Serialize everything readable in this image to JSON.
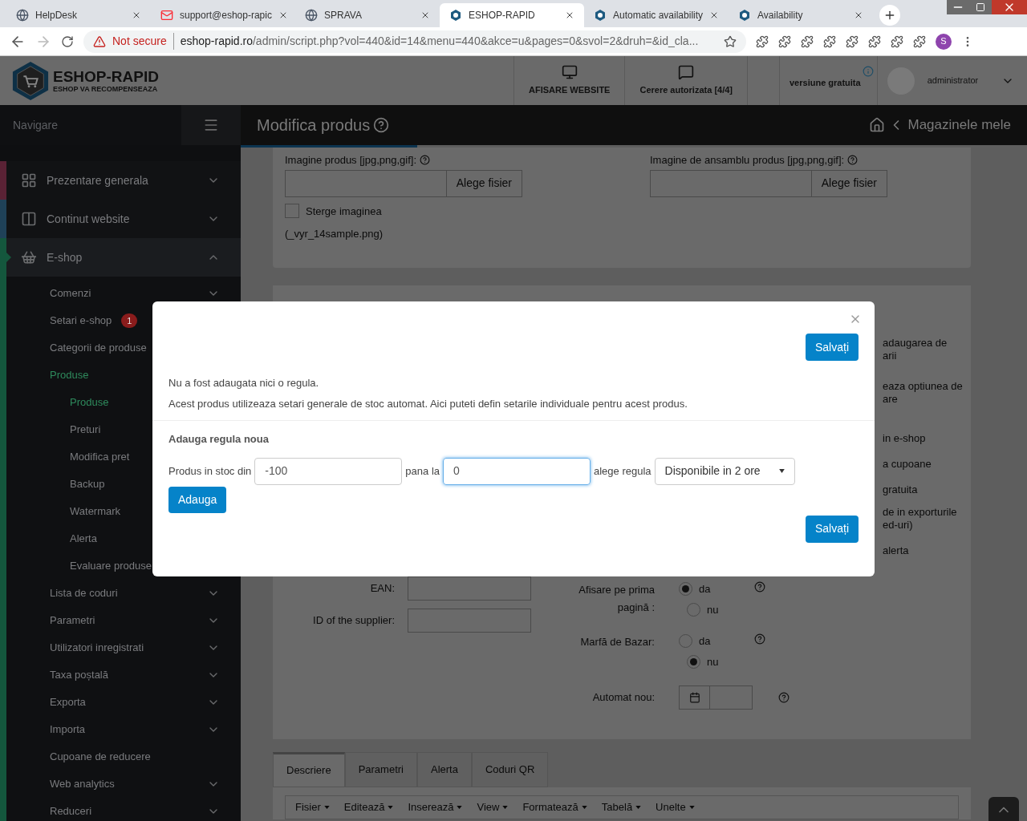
{
  "browser": {
    "tabs": [
      {
        "title": "HelpDesk",
        "kind": "globe",
        "selected": false
      },
      {
        "title": "support@eshop-rapic",
        "kind": "mail",
        "selected": false
      },
      {
        "title": "SPRAVA",
        "kind": "globe",
        "selected": false
      },
      {
        "title": "ESHOP-RAPID",
        "kind": "hex",
        "selected": true
      },
      {
        "title": "Automatic availability",
        "kind": "hex",
        "selected": false
      },
      {
        "title": "Availability",
        "kind": "hex",
        "selected": false
      }
    ],
    "security": "Not secure",
    "url_host": "eshop-rapid.ro",
    "url_path": "/admin/script.php?vol=440&id=14&menu=440&akce=u&pages=0&svol=2&druh=&id_cla...",
    "profile": "S"
  },
  "header": {
    "logo_title": "ESHOP-RAPID",
    "logo_subtitle": "ESHOP VA RECOMPENSEAZA",
    "nav": [
      {
        "label": "AFISARE WEBSITE",
        "kind": "monitor"
      },
      {
        "label": "Cerere autorizata [4/4]",
        "kind": "chat"
      }
    ],
    "version": "versiune gratuita",
    "user": "administrator"
  },
  "sidebar": {
    "heading": "Navigare",
    "items": [
      {
        "label": "Prezentare generala",
        "kind": "group",
        "expanded": false,
        "selected": false,
        "color": "#5a2235"
      },
      {
        "label": "Continut website",
        "kind": "group",
        "expanded": false,
        "selected": false,
        "color": "#1f4158"
      },
      {
        "label": "E-shop",
        "kind": "group",
        "expanded": true,
        "selected": true,
        "color": "#14573d",
        "children": [
          {
            "label": "Comenzi",
            "kind": "group",
            "expanded": false,
            "selected": false
          },
          {
            "label": "Setari e-shop",
            "kind": "link",
            "selected": false,
            "badge": "1"
          },
          {
            "label": "Categorii de produse",
            "kind": "link",
            "selected": false
          },
          {
            "label": "Produse",
            "kind": "link",
            "selected": true,
            "children": [
              {
                "label": "Produse",
                "selected": true
              },
              {
                "label": "Preturi",
                "selected": false
              },
              {
                "label": "Modifica pret",
                "selected": false
              },
              {
                "label": "Backup",
                "selected": false
              },
              {
                "label": "Watermark",
                "selected": false
              },
              {
                "label": "Alerta",
                "selected": false
              },
              {
                "label": "Evaluare produse",
                "selected": false
              }
            ]
          },
          {
            "label": "Lista de coduri",
            "kind": "group",
            "expanded": false,
            "selected": false
          },
          {
            "label": "Parametri",
            "kind": "group",
            "expanded": false,
            "selected": false
          },
          {
            "label": "Utilizatori inregistrati",
            "kind": "group",
            "expanded": false,
            "selected": false
          },
          {
            "label": "Taxa poștală",
            "kind": "group",
            "expanded": false,
            "selected": false
          },
          {
            "label": "Exporta",
            "kind": "group",
            "expanded": false,
            "selected": false
          },
          {
            "label": "Importa",
            "kind": "group",
            "expanded": false,
            "selected": false
          },
          {
            "label": "Cupoane de reducere",
            "kind": "link",
            "selected": false
          },
          {
            "label": "Web analytics",
            "kind": "group",
            "expanded": false,
            "selected": false
          },
          {
            "label": "Reduceri",
            "kind": "group",
            "expanded": false,
            "selected": false
          }
        ]
      }
    ]
  },
  "page_title": "Modifica produs",
  "breadcrumb": "Magazinele mele",
  "uploads": [
    {
      "label": "Imagine produs [jpg,png,gif]:",
      "button": "Alege fisier"
    },
    {
      "label": "Imagine de ansamblu produs [jpg,png,gif]:",
      "button": "Alege fisier"
    }
  ],
  "delete_image": {
    "label": "Sterge imaginea",
    "checked": false
  },
  "filename": "(_vyr_14sample.png)",
  "side_texts": [
    "adaugarea de",
    "arii",
    "eaza optiunea de",
    "are",
    "in e-shop",
    "a cupoane",
    "gratuita",
    "de in exporturile",
    "ed-uri)",
    "alerta"
  ],
  "fields": [
    {
      "label": "EAN:"
    },
    {
      "label": "ID of the supplier:"
    }
  ],
  "radio_groups": [
    {
      "label": "Afisare pe prima pagină :",
      "options": [
        {
          "label": "da",
          "selected": true
        },
        {
          "label": "nu",
          "selected": false
        }
      ]
    },
    {
      "label": "Marfă de Bazar:",
      "options": [
        {
          "label": "da",
          "selected": false
        },
        {
          "label": "nu",
          "selected": true
        }
      ]
    }
  ],
  "date_field": {
    "label": "Automat nou:"
  },
  "tabs": [
    {
      "label": "Descriere",
      "selected": true
    },
    {
      "label": "Parametri",
      "selected": false
    },
    {
      "label": "Alerta",
      "selected": false
    },
    {
      "label": "Coduri QR",
      "selected": false
    }
  ],
  "editor_menu": [
    "Fisier",
    "Editează",
    "Inserează",
    "View",
    "Formatează",
    "Tabelă",
    "Unelte"
  ],
  "modal": {
    "save": "Salvați",
    "messages": [
      "Nu a fost adaugata nici o regula.",
      "Acest produs utilizeaza setari generale de stoc automat. Aici puteti defin setarile individuale pentru acest produs."
    ],
    "section": "Adauga regula noua",
    "from_label": "Produs in stoc din",
    "from": {
      "value": "-100",
      "focused": false
    },
    "to_label": "pana la",
    "to": {
      "value": "0",
      "focused": true
    },
    "rule_label": "alege regula",
    "rule": "Disponibile in 2 ore",
    "add": "Adauga",
    "save_bottom": "Salvați"
  }
}
